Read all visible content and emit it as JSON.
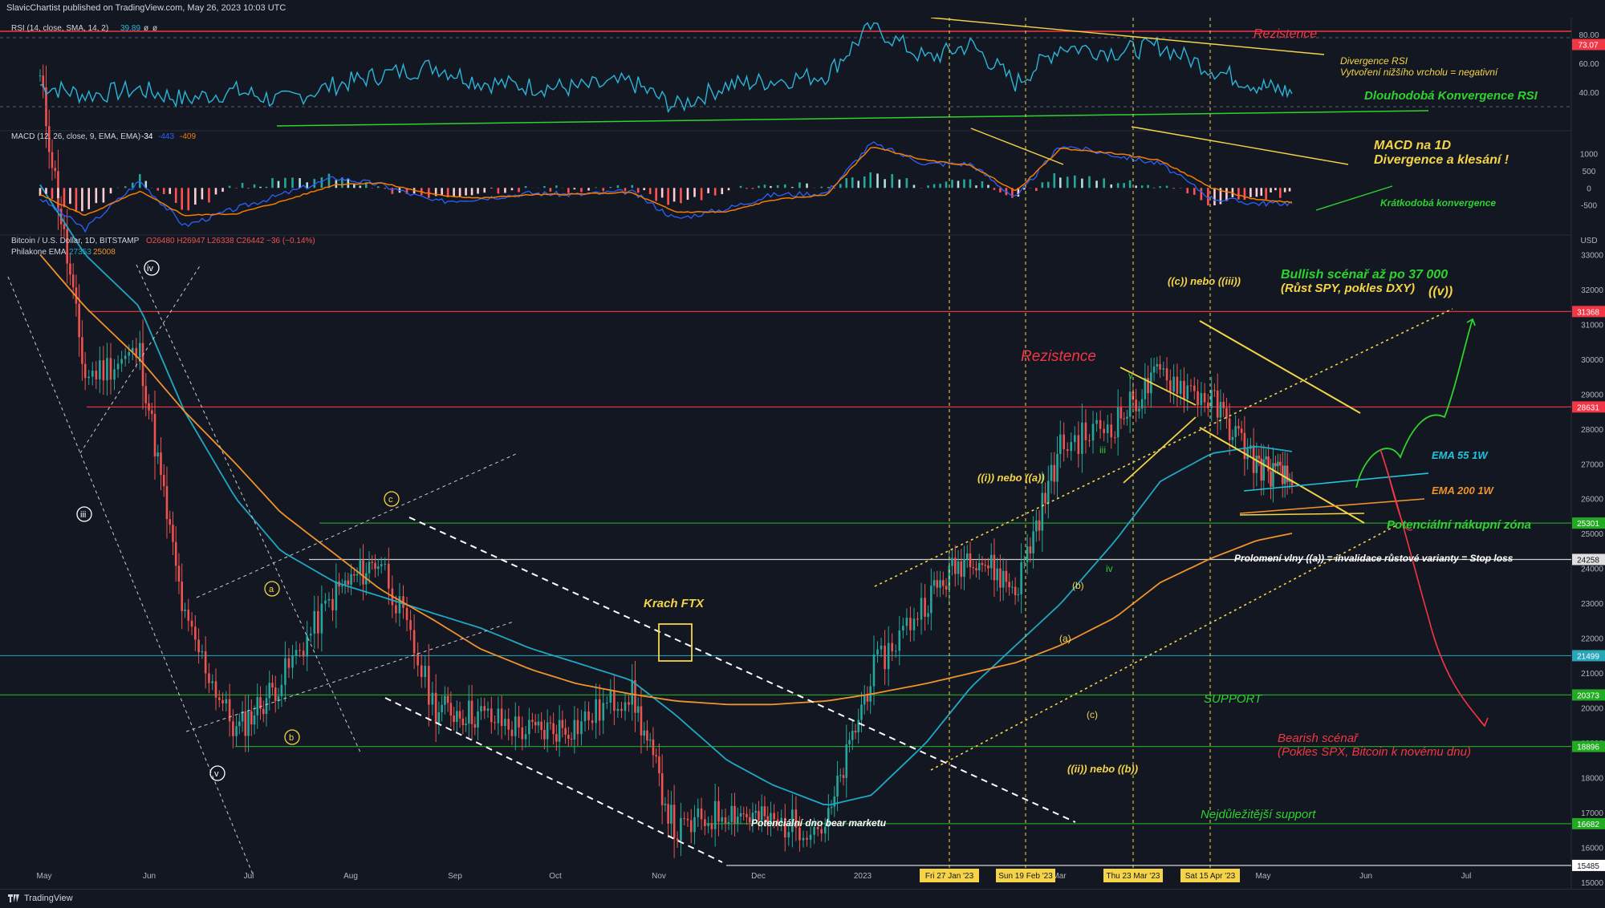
{
  "header": {
    "published": "SlavicChartist published on TradingView.com, May 26, 2023 10:03 UTC"
  },
  "footer": {
    "brand": "TradingView"
  },
  "legends": {
    "rsi": {
      "label": "RSI (14, close, SMA, 14, 2)",
      "v1": "39.89",
      "v2": "ø",
      "v3": "ø"
    },
    "macd": {
      "label": "MACD (12, 26, close, 9, EMA, EMA)",
      "v1": "-34",
      "v2": "-443",
      "v3": "-409"
    },
    "main": {
      "label": "Bitcoin / U.S. Dollar, 1D, BITSTAMP",
      "ohlc": "O26480 H26947 L26338 C26442 −36 (−0.14%)"
    },
    "ema": {
      "label": "Philakone EMA",
      "v1": "27353",
      "v2": "25008"
    }
  },
  "price_scale": {
    "currency": "USD",
    "ticks": [
      33000,
      32000,
      31000,
      30000,
      29000,
      28000,
      27000,
      26000,
      25000,
      24000,
      23000,
      22000,
      21000,
      20000,
      19000,
      18000,
      17000,
      16000,
      15000
    ]
  },
  "rsi_scale": {
    "ticks": [
      "80.00",
      "60.00",
      "40.00"
    ],
    "badge": "73.07"
  },
  "macd_scale": {
    "ticks": [
      "1000",
      "500",
      "0",
      "-500"
    ]
  },
  "price_levels": [
    {
      "value": 31368,
      "label": "31368",
      "color": "#f23645"
    },
    {
      "value": 28631,
      "label": "28631",
      "color": "#f23645"
    },
    {
      "value": 25301,
      "label": "25301",
      "color": "#22ab22"
    },
    {
      "value": 24258,
      "label": "24258",
      "color": "#e0e0e0"
    },
    {
      "value": 21499,
      "label": "21499",
      "color": "#26a6b8"
    },
    {
      "value": 20373,
      "label": "20373",
      "color": "#22ab22"
    },
    {
      "value": 18896,
      "label": "18896",
      "color": "#22ab22"
    },
    {
      "value": 16682,
      "label": "16682",
      "color": "#22ab22"
    },
    {
      "value": 15485,
      "label": "15485",
      "color": "#ffffff"
    }
  ],
  "time_axis": {
    "months": [
      "May",
      "Jun",
      "Jul",
      "Aug",
      "Sep",
      "Oct",
      "Nov",
      "Dec",
      "2023",
      "Mar",
      "May",
      "Jun",
      "Jul"
    ],
    "date_badges": [
      "Fri 27 Jan '23",
      "Sun 19 Feb '23",
      "Thu 23 Mar '23",
      "Sat 15 Apr '23"
    ]
  },
  "annotations": {
    "rsi_resistance": "Rezistence",
    "rsi_divergence_1": "Divergence RSI",
    "rsi_divergence_2": "Vytvoření nižšího vrcholu = negativní",
    "rsi_convergence": "Dlouhodobá Konvergence RSI",
    "macd_1": "MACD na 1D",
    "macd_2": "Divergence a klesání !",
    "macd_conv": "Krátkodobá konvergence",
    "wave_c_iii": "((c)) nebo ((iii))",
    "bull_1": "Bullish scénař až po 37 000",
    "bull_2": "(Růst SPY, pokles DXY)",
    "wave_v": "((v))",
    "resistance": "Rezistence",
    "ema55": "EMA 55 1W",
    "ema200": "EMA 200 1W",
    "buy_zone": "Potenciální nákupní zóna",
    "stop_loss": "Prolomení vlny ((a)) = invalidace růstové varianty = Stop loss",
    "support": "SUPPORT",
    "bear_1": "Bearish scénař",
    "bear_2": "(Pokles SPX, Bitcoin k novému dnu)",
    "most_support": "Nejdůležitější support",
    "bear_bottom": "Potenciální dno bear marketu",
    "ftx": "Krach FTX",
    "wave_i_a": "((i)) nebo ((a))",
    "wave_ii_b": "((ii)) nebo ((b))",
    "w_iv_top": "iv",
    "w_iii_left": "iii",
    "w_v_left": "v",
    "w_a": "a",
    "w_b": "b",
    "w_c": "c",
    "w_paren_b": "(b)",
    "w_paren_a": "(a)",
    "w_paren_c": "(c)",
    "w_iii_right": "iii",
    "w_iv_right": "iv",
    "w_v_right": "v"
  },
  "colors": {
    "bg": "#131722",
    "grid": "#1e222d",
    "rsi": "#2bb5d8",
    "macd": "#2962ff",
    "signal": "#f57c00",
    "ema55": "#1fa8c4",
    "ema200": "#f0932b",
    "up": "#26a69a",
    "down": "#ef5350",
    "annot_red": "#f23645",
    "annot_green": "#2ed22e",
    "annot_yellow": "#f5d547",
    "annot_cyan": "#22c4dc",
    "annot_orange": "#f0932b"
  },
  "chart_data": {
    "type": "candlestick",
    "title": "Bitcoin / U.S. Dollar, 1D, BITSTAMP",
    "ylabel": "USD",
    "ylim": [
      15000,
      33400
    ],
    "x": [
      "2022-05-01",
      "2022-05-15",
      "2022-06-01",
      "2022-06-15",
      "2022-07-01",
      "2022-07-15",
      "2022-08-01",
      "2022-08-15",
      "2022-09-01",
      "2022-09-15",
      "2022-10-01",
      "2022-10-15",
      "2022-11-01",
      "2022-11-15",
      "2022-12-01",
      "2022-12-15",
      "2023-01-01",
      "2023-01-15",
      "2023-02-01",
      "2023-02-15",
      "2023-03-01",
      "2023-03-15",
      "2023-04-01",
      "2023-04-15",
      "2023-05-01",
      "2023-05-15",
      "2023-05-26"
    ],
    "series": [
      {
        "name": "Philakone EMA 55",
        "values": [
          35000,
          33000,
          31500,
          28500,
          26000,
          24500,
          23600,
          23200,
          22700,
          22300,
          21700,
          21300,
          20800,
          19800,
          18500,
          17800,
          17200,
          17500,
          19000,
          20600,
          21800,
          23000,
          24800,
          26500,
          27300,
          27500,
          27353
        ]
      },
      {
        "name": "Philakone EMA 200",
        "values": [
          33000,
          31500,
          30000,
          28500,
          27000,
          25600,
          24400,
          23400,
          22500,
          21700,
          21100,
          20700,
          20400,
          20200,
          20100,
          20100,
          20200,
          20400,
          20700,
          21000,
          21300,
          21800,
          22600,
          23600,
          24300,
          24800,
          25008
        ]
      },
      {
        "name": "BTC close",
        "values": [
          38000,
          29500,
          30200,
          22500,
          19300,
          20800,
          23300,
          24300,
          20000,
          19800,
          19300,
          19500,
          20500,
          16400,
          17100,
          16700,
          16600,
          21000,
          23100,
          24500,
          23400,
          27500,
          28200,
          29600,
          28800,
          27000,
          26442
        ]
      }
    ],
    "rsi": {
      "ylim": [
        15,
        90
      ],
      "levels": [
        80,
        70,
        30
      ],
      "values": [
        45,
        38,
        42,
        35,
        41,
        34,
        45,
        52,
        58,
        47,
        44,
        43,
        47,
        30,
        45,
        48,
        52,
        86,
        63,
        73,
        46,
        72,
        68,
        72,
        56,
        45,
        39.89
      ]
    },
    "macd": {
      "ylim": [
        -1300,
        1500
      ],
      "values": [
        -300,
        -1200,
        200,
        -1100,
        -600,
        -200,
        300,
        100,
        -400,
        -300,
        -150,
        -200,
        -100,
        -900,
        -600,
        -200,
        -150,
        1300,
        700,
        700,
        -300,
        1250,
        950,
        700,
        -300,
        -450,
        -443
      ],
      "signal": [
        -200,
        -800,
        -100,
        -800,
        -750,
        -400,
        100,
        150,
        -200,
        -300,
        -200,
        -180,
        -130,
        -700,
        -700,
        -350,
        -200,
        1200,
        800,
        650,
        -100,
        1150,
        1000,
        800,
        0,
        -350,
        -409
      ]
    }
  }
}
